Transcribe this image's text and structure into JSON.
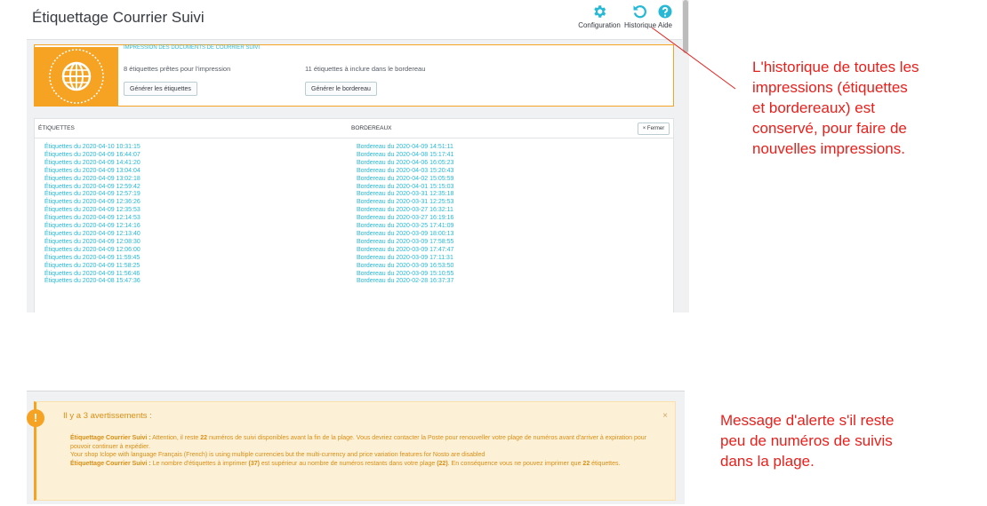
{
  "header": {
    "title": "Étiquettage Courrier Suivi",
    "toolbar": [
      {
        "label": "Configuration",
        "icon": "gear-icon"
      },
      {
        "label": "Historique",
        "icon": "history-icon"
      },
      {
        "label": "Aide",
        "icon": "help-icon"
      }
    ]
  },
  "print_panel": {
    "heading": "IMPRESSION DES DOCUMENTS DE COURRIER SUIVI",
    "labels_ready": "8 étiquettes prêtes pour l'impression",
    "labels_button": "Générer les étiquettes",
    "bordereau_ready": "11 étiquettes à inclure dans le bordereau",
    "bordereau_button": "Générer le bordereau"
  },
  "history_panel": {
    "col_labels": "ÉTIQUETTES",
    "col_bordereaux": "BORDEREAUX",
    "close_label": "× Fermer",
    "etiquettes": [
      "Étiquettes du 2020-04-10 10:31:15",
      "Étiquettes du 2020-04-09 16:44:07",
      "Étiquettes du 2020-04-09 14:41:20",
      "Étiquettes du 2020-04-09 13:04:04",
      "Étiquettes du 2020-04-09 13:02:18",
      "Étiquettes du 2020-04-09 12:59:42",
      "Étiquettes du 2020-04-09 12:57:19",
      "Étiquettes du 2020-04-09 12:36:26",
      "Étiquettes du 2020-04-09 12:35:53",
      "Étiquettes du 2020-04-09 12:14:53",
      "Étiquettes du 2020-04-09 12:14:16",
      "Étiquettes du 2020-04-09 12:13:40",
      "Étiquettes du 2020-04-09 12:08:30",
      "Étiquettes du 2020-04-09 12:06:00",
      "Étiquettes du 2020-04-09 11:59:45",
      "Étiquettes du 2020-04-09 11:58:25",
      "Étiquettes du 2020-04-09 11:56:46",
      "Étiquettes du 2020-04-08 15:47:36"
    ],
    "bordereaux": [
      "Bordereau du 2020-04-09 14:51:11",
      "Bordereau du 2020-04-08 15:17:41",
      "Bordereau du 2020-04-06 16:05:23",
      "Bordereau du 2020-04-03 15:20:43",
      "Bordereau du 2020-04-02 15:05:59",
      "Bordereau du 2020-04-01 15:15:03",
      "Bordereau du 2020-03-31 12:35:18",
      "Bordereau du 2020-03-31 12:25:53",
      "Bordereau du 2020-03-27 16:32:11",
      "Bordereau du 2020-03-27 16:19:16",
      "Bordereau du 2020-03-25 17:41:09",
      "Bordereau du 2020-03-09 18:00:13",
      "Bordereau du 2020-03-09 17:58:55",
      "Bordereau du 2020-03-09 17:47:47",
      "Bordereau du 2020-03-09 17:11:31",
      "Bordereau du 2020-03-09 16:53:50",
      "Bordereau du 2020-03-09 15:10:55",
      "Bordereau du 2020-02-28 16:37:37"
    ]
  },
  "annotations": {
    "history_note": [
      "L'historique de toutes les",
      "impressions (étiquettes",
      "et bordereaux) est",
      "conservé, pour faire de",
      "nouvelles impressions."
    ],
    "alert_note": [
      "Message d'alerte s'il reste",
      "peu de numéros de suivis",
      "dans la plage."
    ]
  },
  "alert": {
    "icon_glyph": "!",
    "title": "Il y a 3 avertissements :",
    "close": "×",
    "line1_strong": "Étiquettage Courrier Suivi :",
    "line1_a": " Attention, il reste ",
    "line1_num": "22",
    "line1_b": " numéros de suivi disponibles avant la fin de la plage. Vous devriez contacter la Poste pour renouveller votre plage de numéros avant d'arriver à expiration pour pouvoir continuer à expédier.",
    "line2": "Your shop Iclope with language Français (French) is using multiple currencies but the multi-currency and price variation features for Nosto are disabled",
    "line3_strong": "Étiquettage Courrier Suivi :",
    "line3_a": " Le nombre d'étiquettes à imprimer ",
    "line3_num1": "(37)",
    "line3_b": " est supérieur au nombre de numéros restants dans votre plage ",
    "line3_num2": "(22)",
    "line3_c": ". En conséquence vous ne pouvez imprimer que ",
    "line3_num3": "22",
    "line3_d": " étiquettes."
  },
  "colors": {
    "accent": "#25b9d7",
    "warning": "#f6a323",
    "annotation": "#e8201c"
  }
}
